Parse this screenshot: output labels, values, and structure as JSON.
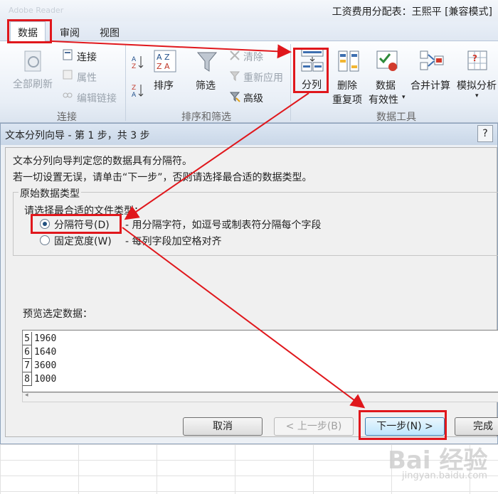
{
  "window": {
    "app_ghost": "Adobe Reader",
    "doc_title": "工资费用分配表：王熙平  [兼容模式]"
  },
  "tabs": [
    {
      "label": "数据",
      "active": true
    },
    {
      "label": "审阅",
      "active": false
    },
    {
      "label": "视图",
      "active": false
    }
  ],
  "ribbon": {
    "connections": {
      "refresh_all": "全部刷新",
      "connect": "连接",
      "properties": "属性",
      "edit_links": "编辑链接",
      "group_label": "连接"
    },
    "sort_filter": {
      "sort": "排序",
      "filter": "筛选",
      "clear": "清除",
      "reapply": "重新应用",
      "advanced": "高级",
      "group_label": "排序和筛选"
    },
    "data_tools": {
      "text_to_columns": "分列",
      "remove_duplicates_1": "删除",
      "remove_duplicates_2": "重复项",
      "data_validation_1": "数据",
      "data_validation_2": "有效性",
      "consolidate": "合并计算",
      "what_if": "模拟分析",
      "group_label": "数据工具"
    }
  },
  "dialog": {
    "title": "文本分列向导 - 第 1 步，共 3 步",
    "help": "?",
    "line1": "文本分列向导判定您的数据具有分隔符。",
    "line2": "若一切设置无误，请单击“下一步”，否则请选择最合适的数据类型。",
    "group_title": "原始数据类型",
    "choose_label": "请选择最合适的文件类型：",
    "options": [
      {
        "label": "分隔符号(D)",
        "desc": "- 用分隔字符，如逗号或制表符分隔每个字段",
        "checked": true
      },
      {
        "label": "固定宽度(W)",
        "desc": "- 每列字段加空格对齐",
        "checked": false
      }
    ],
    "preview_label": "预览选定数据：",
    "preview_rows": [
      {
        "num": "5",
        "value": "1960"
      },
      {
        "num": "6",
        "value": "1640"
      },
      {
        "num": "7",
        "value": "3600"
      },
      {
        "num": "8",
        "value": "1000"
      }
    ],
    "buttons": {
      "cancel": "取消",
      "back": "< 上一步(B)",
      "next": "下一步(N) >",
      "finish": "完成"
    }
  },
  "watermark": {
    "brand": "Bai 经验",
    "url": "jingyan.baidu.com"
  },
  "colors": {
    "highlight": "#e0171c"
  }
}
